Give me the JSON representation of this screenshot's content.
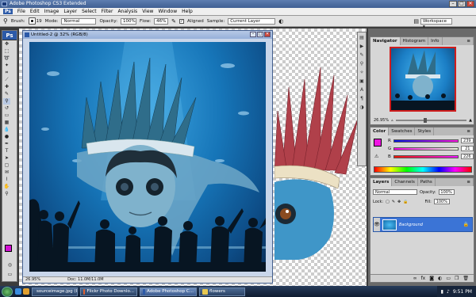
{
  "window": {
    "title": "Adobe Photoshop CS3 Extended",
    "min": "–",
    "max": "□",
    "close": "✕"
  },
  "menu": [
    "Ps",
    "File",
    "Edit",
    "Image",
    "Layer",
    "Select",
    "Filter",
    "Analysis",
    "View",
    "Window",
    "Help"
  ],
  "options": {
    "brush_label": "Brush:",
    "brush_size": "19",
    "mode_label": "Mode:",
    "mode_value": "Normal",
    "opacity_label": "Opacity:",
    "opacity_value": "100%",
    "flow_label": "Flow:",
    "flow_value": "46%",
    "aligned_label": "Aligned",
    "sample_label": "Sample:",
    "sample_value": "Current Layer",
    "workspace_label": "Workspace ▾"
  },
  "toolbox": {
    "logo": "Ps",
    "fg_color": "#d410d4",
    "bg_color": "#ffffff"
  },
  "document": {
    "title": "Untitled-2 @ 32% (RGB/8)",
    "zoom": "26.95%",
    "doc_size": "Doc: 11.0M/11.0M"
  },
  "navigator": {
    "tabs": [
      "Navigator",
      "Histogram",
      "Info"
    ],
    "zoom": "26.95%"
  },
  "color": {
    "tabs": [
      "Color",
      "Swatches",
      "Styles"
    ],
    "r": "239",
    "g": "21",
    "b": "226",
    "swatch": "#ef15e2"
  },
  "layers": {
    "tabs": [
      "Layers",
      "Channels",
      "Paths"
    ],
    "blend": "Normal",
    "opacity_label": "Opacity:",
    "opacity_value": "100%",
    "lock_label": "Lock:",
    "fill_label": "Fill:",
    "fill_value": "100%",
    "layer_name": "Background"
  },
  "taskbar": {
    "items": [
      "sourceimage.jpg (IP...",
      "Flickr Photo Downlo...",
      "Adobe Photoshop C...",
      "flowers"
    ],
    "time": "9:51 PM"
  }
}
